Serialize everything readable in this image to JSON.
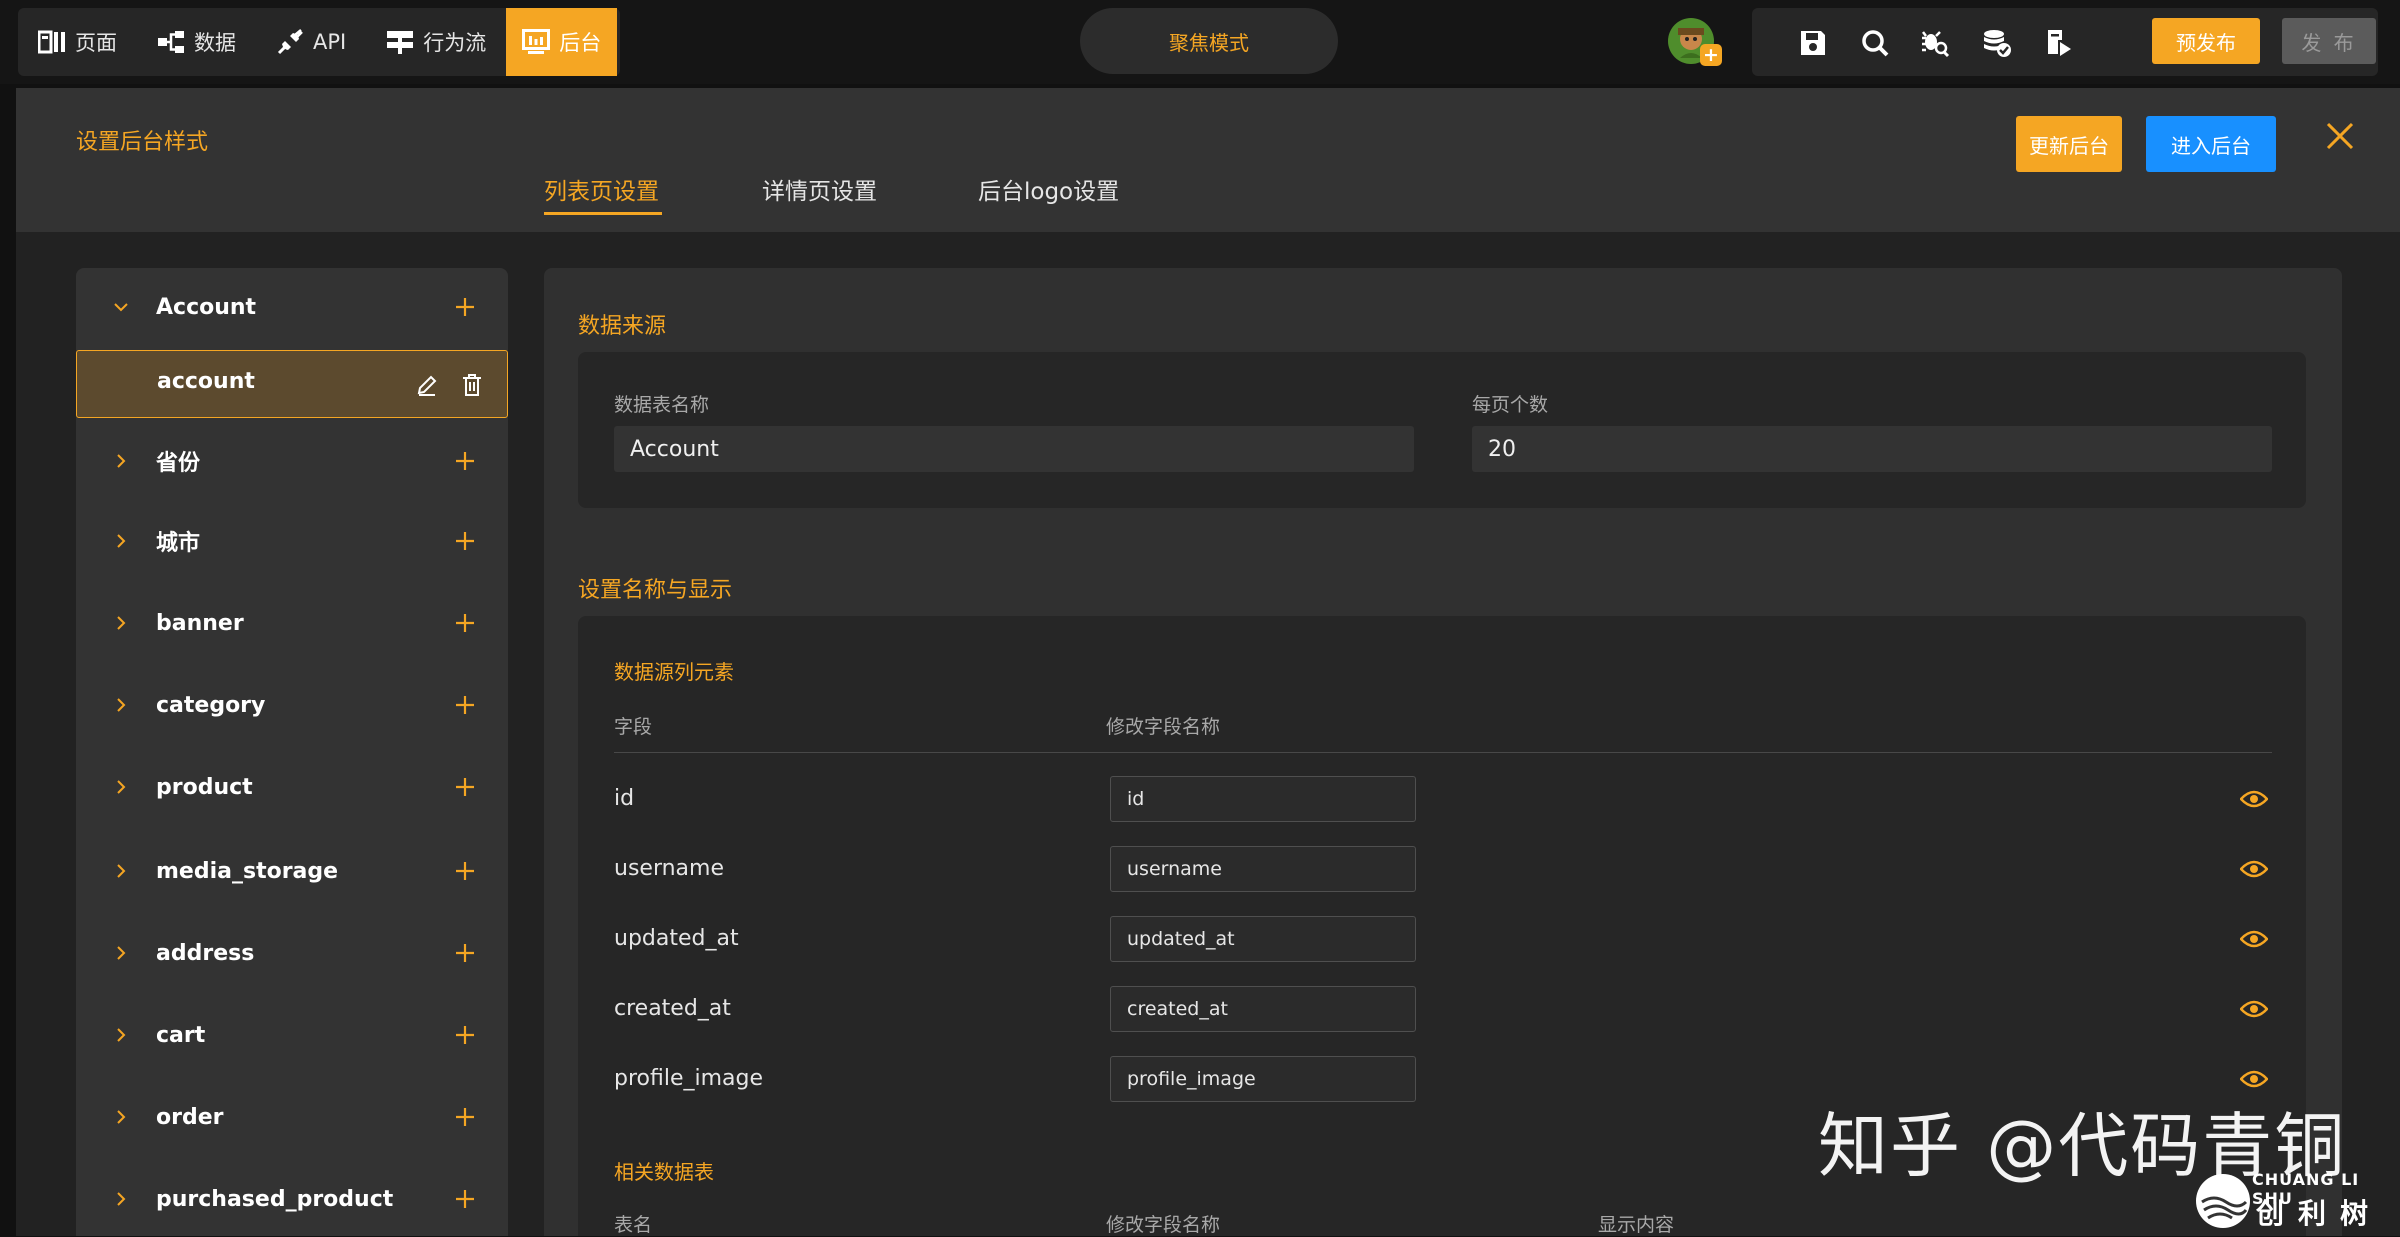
{
  "nav": {
    "items": [
      {
        "label": "页面",
        "icon": "page-layout-icon"
      },
      {
        "label": "数据",
        "icon": "data-tree-icon"
      },
      {
        "label": "API",
        "icon": "api-plug-icon"
      },
      {
        "label": "行为流",
        "icon": "flow-icon"
      },
      {
        "label": "后台",
        "icon": "dashboard-icon"
      }
    ],
    "active_index": 4
  },
  "focus_mode": {
    "label": "聚焦模式"
  },
  "toolbar": {
    "icons": [
      "save-icon",
      "search-icon",
      "debug-search-icon",
      "database-check-icon",
      "preview-play-icon"
    ],
    "prepublish_label": "预发布",
    "publish_label": "发 布"
  },
  "panel": {
    "title": "设置后台样式",
    "tabs": [
      {
        "label": "列表页设置"
      },
      {
        "label": "详情页设置"
      },
      {
        "label": "后台logo设置"
      }
    ],
    "active_tab": 0,
    "update_button": "更新后台",
    "enter_button": "进入后台"
  },
  "sidebar": {
    "group": {
      "label": "Account",
      "expanded": true
    },
    "selected": {
      "label": "account"
    },
    "items": [
      {
        "label": "省份"
      },
      {
        "label": "城市"
      },
      {
        "label": "banner"
      },
      {
        "label": "category"
      },
      {
        "label": "product"
      },
      {
        "label": "media_storage"
      },
      {
        "label": "address"
      },
      {
        "label": "cart"
      },
      {
        "label": "order"
      },
      {
        "label": "purchased_product"
      }
    ]
  },
  "data_source": {
    "title": "数据来源",
    "table_name_label": "数据表名称",
    "table_name_value": "Account",
    "page_size_label": "每页个数",
    "page_size_value": "20"
  },
  "naming": {
    "title": "设置名称与显示",
    "columns_title": "数据源列元素",
    "col_field": "字段",
    "col_rename": "修改字段名称",
    "rows": [
      {
        "field": "id",
        "rename": "id"
      },
      {
        "field": "username",
        "rename": "username"
      },
      {
        "field": "updated_at",
        "rename": "updated_at"
      },
      {
        "field": "created_at",
        "rename": "created_at"
      },
      {
        "field": "profile_image",
        "rename": "profile_image"
      }
    ],
    "related_title": "相关数据表",
    "related_col_table": "表名",
    "related_col_rename": "修改字段名称",
    "related_col_display": "显示内容"
  },
  "watermark": {
    "text": "知乎 @代码青铜",
    "brand_en": "CHUANG LI SHU",
    "brand_cn": "创利树"
  },
  "colors": {
    "accent": "#f5a623",
    "primary": "#1890ff"
  }
}
